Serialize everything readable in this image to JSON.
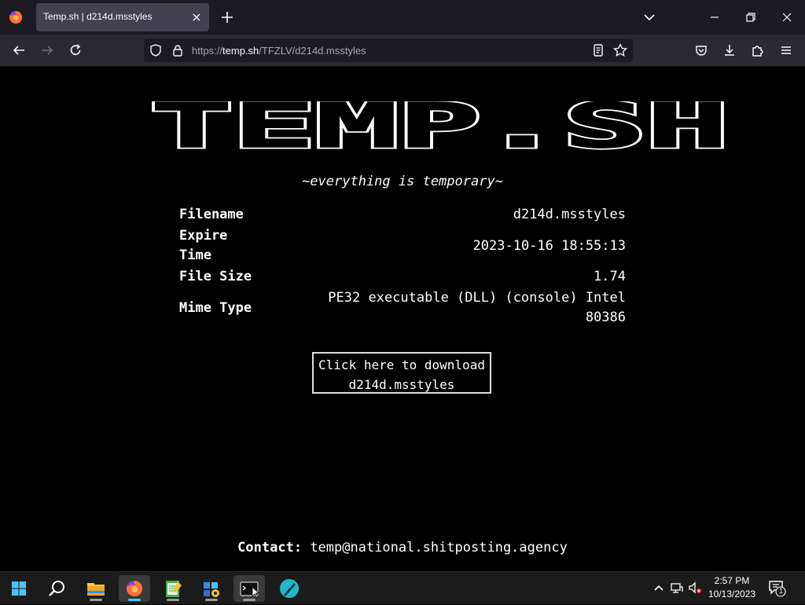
{
  "browser": {
    "tab_title": "Temp.sh | d214d.msstyles",
    "url_scheme": "https://",
    "url_host": "temp.sh",
    "url_path": "/TFZLV/d214d.msstyles"
  },
  "page": {
    "logo_text": "TEMP.SH",
    "tagline": "~everything is temporary~",
    "info_rows": [
      {
        "label": "Filename",
        "value": "d214d.msstyles"
      },
      {
        "label": "Expire Time",
        "value": "2023-10-16 18:55:13"
      },
      {
        "label": "File Size",
        "value": "1.74"
      },
      {
        "label": "Mime Type",
        "value": "PE32 executable (DLL) (console) Intel 80386"
      }
    ],
    "download_line1": "Click here to download",
    "download_line2": "d214d.msstyles",
    "contact_label": "Contact:",
    "contact_email": "temp@national.shitposting.agency"
  },
  "taskbar": {
    "apps": [
      "start-icon",
      "search-icon",
      "file-explorer-icon",
      "firefox-icon",
      "notepad-icon",
      "settings-app-icon",
      "terminal-icon",
      "pen-app-icon"
    ],
    "time": "2:57 PM",
    "date": "10/13/2023",
    "notification_count": "1"
  },
  "colors": {
    "tab_bar": "#1c1b22",
    "nav_bar": "#2b2a33",
    "page_bg": "#000000",
    "text": "#ffffff",
    "accent": "#4cc2ff"
  }
}
